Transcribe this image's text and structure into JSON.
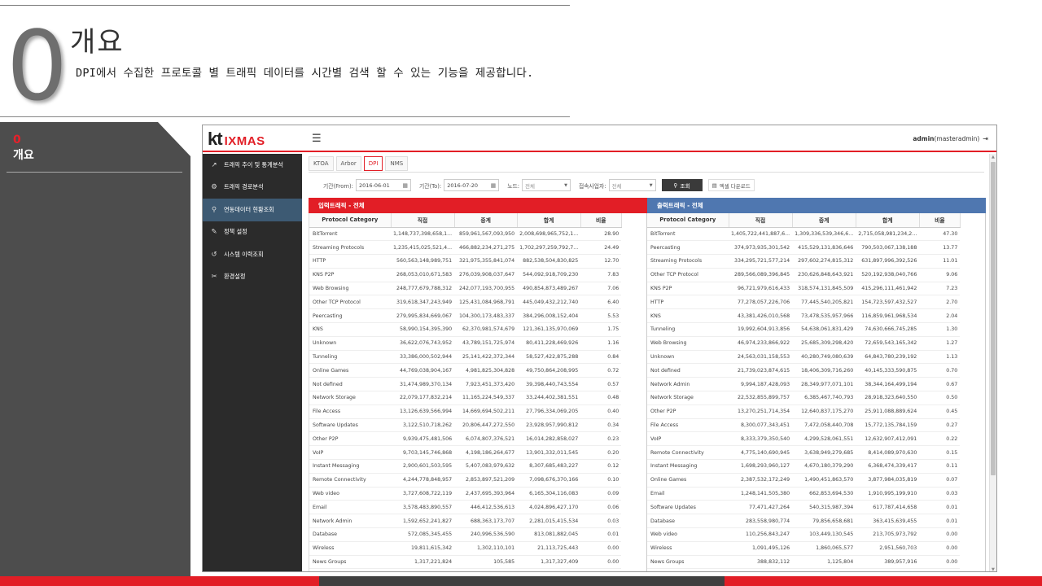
{
  "slide": {
    "number": "0",
    "title": "개요",
    "description": "DPI에서 수집한 프로토콜 별 트래픽 데이터를 시간별 검색 할 수 있는 기능을 제공합니다.",
    "side_number": "0",
    "side_label": "개요"
  },
  "colors": {
    "accent": "#e21e26",
    "dark": "#404040",
    "outbound": "#4f77b0",
    "sidebar": "#2b2b2b",
    "sidebar_active": "#3d5a73"
  },
  "app": {
    "logo_kt": "kt",
    "logo_product": "IXMAS",
    "menu_icon": "hamburger-icon",
    "user": "admin",
    "user_role": "(masteradmin)",
    "logout_icon": "logout-icon"
  },
  "sidebar": {
    "items": [
      {
        "icon": "chart-line-icon",
        "glyph": "↗",
        "label": "트래픽 추이 및 통계분석",
        "active": false
      },
      {
        "icon": "gear-route-icon",
        "glyph": "⚙",
        "label": "트래픽 경로분석",
        "active": false
      },
      {
        "icon": "search-icon",
        "glyph": "⚲",
        "label": "연동데이터 현황조회",
        "active": true
      },
      {
        "icon": "policy-icon",
        "glyph": "✎",
        "label": "정책 설정",
        "active": false
      },
      {
        "icon": "history-icon",
        "glyph": "↺",
        "label": "시스템 이력조회",
        "active": false
      },
      {
        "icon": "wrench-icon",
        "glyph": "✂",
        "label": "환경설정",
        "active": false
      }
    ]
  },
  "tabs": [
    {
      "label": "KTOA",
      "active": false
    },
    {
      "label": "Arbor",
      "active": false
    },
    {
      "label": "DPI",
      "active": true
    },
    {
      "label": "NMS",
      "active": false
    }
  ],
  "filters": {
    "from_label": "기간(From):",
    "from_value": "2016-06-01",
    "to_label": "기간(To):",
    "to_value": "2016-07-20",
    "node_label": "노드:",
    "node_value": "전체",
    "site_label": "접속사업자:",
    "site_value": "전체",
    "search_button": "조회",
    "excel_button": "엑셀 다운로드"
  },
  "columns": [
    "Protocol Category",
    "직접",
    "중계",
    "합계",
    "비율"
  ],
  "inbound": {
    "title": "입력트래픽 - 전체",
    "rows": [
      [
        "BitTorrent",
        "1,148,737,398,658,1...",
        "859,961,567,093,950",
        "2,008,698,965,752,1...",
        "28.90"
      ],
      [
        "Streaming Protocols",
        "1,235,415,025,521,4...",
        "466,882,234,271,275",
        "1,702,297,259,792,7...",
        "24.49"
      ],
      [
        "HTTP",
        "560,563,148,989,751",
        "321,975,355,841,074",
        "882,538,504,830,825",
        "12.70"
      ],
      [
        "KNS P2P",
        "268,053,010,671,583",
        "276,039,908,037,647",
        "544,092,918,709,230",
        "7.83"
      ],
      [
        "Web Browsing",
        "248,777,679,788,312",
        "242,077,193,700,955",
        "490,854,873,489,267",
        "7.06"
      ],
      [
        "Other TCP Protocol",
        "319,618,347,243,949",
        "125,431,084,968,791",
        "445,049,432,212,740",
        "6.40"
      ],
      [
        "Peercasting",
        "279,995,834,669,067",
        "104,300,173,483,337",
        "384,296,008,152,404",
        "5.53"
      ],
      [
        "KNS",
        "58,990,154,395,390",
        "62,370,981,574,679",
        "121,361,135,970,069",
        "1.75"
      ],
      [
        "Unknown",
        "36,622,076,743,952",
        "43,789,151,725,974",
        "80,411,228,469,926",
        "1.16"
      ],
      [
        "Tunneling",
        "33,386,000,502,944",
        "25,141,422,372,344",
        "58,527,422,875,288",
        "0.84"
      ],
      [
        "Online Games",
        "44,769,038,904,167",
        "4,981,825,304,828",
        "49,750,864,208,995",
        "0.72"
      ],
      [
        "Not defined",
        "31,474,989,370,134",
        "7,923,451,373,420",
        "39,398,440,743,554",
        "0.57"
      ],
      [
        "Network Storage",
        "22,079,177,832,214",
        "11,165,224,549,337",
        "33,244,402,381,551",
        "0.48"
      ],
      [
        "File Access",
        "13,126,639,566,994",
        "14,669,694,502,211",
        "27,796,334,069,205",
        "0.40"
      ],
      [
        "Software Updates",
        "3,122,510,718,262",
        "20,806,447,272,550",
        "23,928,957,990,812",
        "0.34"
      ],
      [
        "Other P2P",
        "9,939,475,481,506",
        "6,074,807,376,521",
        "16,014,282,858,027",
        "0.23"
      ],
      [
        "VoIP",
        "9,703,145,746,868",
        "4,198,186,264,677",
        "13,901,332,011,545",
        "0.20"
      ],
      [
        "Instant Messaging",
        "2,900,601,503,595",
        "5,407,083,979,632",
        "8,307,685,483,227",
        "0.12"
      ],
      [
        "Remote Connectivity",
        "4,244,778,848,957",
        "2,853,897,521,209",
        "7,098,676,370,166",
        "0.10"
      ],
      [
        "Web video",
        "3,727,608,722,119",
        "2,437,695,393,964",
        "6,165,304,116,083",
        "0.09"
      ],
      [
        "Email",
        "3,578,483,890,557",
        "446,412,536,613",
        "4,024,896,427,170",
        "0.06"
      ],
      [
        "Network Admin",
        "1,592,652,241,827",
        "688,363,173,707",
        "2,281,015,415,534",
        "0.03"
      ],
      [
        "Database",
        "572,085,345,455",
        "240,996,536,590",
        "813,081,882,045",
        "0.01"
      ],
      [
        "Wireless",
        "19,811,615,342",
        "1,302,110,101",
        "21,113,725,443",
        "0.00"
      ],
      [
        "News Groups",
        "1,317,221,824",
        "105,585",
        "1,317,327,409",
        "0.00"
      ]
    ]
  },
  "outbound": {
    "title": "출력트래픽 - 전체",
    "rows": [
      [
        "BitTorrent",
        "1,405,722,441,887,6...",
        "1,309,336,539,346,6...",
        "2,715,058,981,234,2...",
        "47.30"
      ],
      [
        "Peercasting",
        "374,973,935,301,542",
        "415,529,131,836,646",
        "790,503,067,138,188",
        "13.77"
      ],
      [
        "Streaming Protocols",
        "334,295,721,577,214",
        "297,602,274,815,312",
        "631,897,996,392,526",
        "11.01"
      ],
      [
        "Other TCP Protocol",
        "289,566,089,396,845",
        "230,626,848,643,921",
        "520,192,938,040,766",
        "9.06"
      ],
      [
        "KNS P2P",
        "96,721,979,616,433",
        "318,574,131,845,509",
        "415,296,111,461,942",
        "7.23"
      ],
      [
        "HTTP",
        "77,278,057,226,706",
        "77,445,540,205,821",
        "154,723,597,432,527",
        "2.70"
      ],
      [
        "KNS",
        "43,381,426,010,568",
        "73,478,535,957,966",
        "116,859,961,968,534",
        "2.04"
      ],
      [
        "Tunneling",
        "19,992,604,913,856",
        "54,638,061,831,429",
        "74,630,666,745,285",
        "1.30"
      ],
      [
        "Web Browsing",
        "46,974,233,866,922",
        "25,685,309,298,420",
        "72,659,543,165,342",
        "1.27"
      ],
      [
        "Unknown",
        "24,563,031,158,553",
        "40,280,749,080,639",
        "64,843,780,239,192",
        "1.13"
      ],
      [
        "Not defined",
        "21,739,023,874,615",
        "18,406,309,716,260",
        "40,145,333,590,875",
        "0.70"
      ],
      [
        "Network Admin",
        "9,994,187,428,093",
        "28,349,977,071,101",
        "38,344,164,499,194",
        "0.67"
      ],
      [
        "Network Storage",
        "22,532,855,899,757",
        "6,385,467,740,793",
        "28,918,323,640,550",
        "0.50"
      ],
      [
        "Other P2P",
        "13,270,251,714,354",
        "12,640,837,175,270",
        "25,911,088,889,624",
        "0.45"
      ],
      [
        "File Access",
        "8,300,077,343,451",
        "7,472,058,440,708",
        "15,772,135,784,159",
        "0.27"
      ],
      [
        "VoIP",
        "8,333,379,350,540",
        "4,299,528,061,551",
        "12,632,907,412,091",
        "0.22"
      ],
      [
        "Remote Connectivity",
        "4,775,140,690,945",
        "3,638,949,279,685",
        "8,414,089,970,630",
        "0.15"
      ],
      [
        "Instant Messaging",
        "1,698,293,960,127",
        "4,670,180,379,290",
        "6,368,474,339,417",
        "0.11"
      ],
      [
        "Online Games",
        "2,387,532,172,249",
        "1,490,451,863,570",
        "3,877,984,035,819",
        "0.07"
      ],
      [
        "Email",
        "1,248,141,505,380",
        "662,853,694,530",
        "1,910,995,199,910",
        "0.03"
      ],
      [
        "Software Updates",
        "77,471,427,264",
        "540,315,987,394",
        "617,787,414,658",
        "0.01"
      ],
      [
        "Database",
        "283,558,980,774",
        "79,856,658,681",
        "363,415,639,455",
        "0.01"
      ],
      [
        "Web video",
        "110,256,843,247",
        "103,449,130,545",
        "213,705,973,792",
        "0.00"
      ],
      [
        "Wireless",
        "1,091,495,126",
        "1,860,065,577",
        "2,951,560,703",
        "0.00"
      ],
      [
        "News Groups",
        "388,832,112",
        "1,125,804",
        "389,957,916",
        "0.00"
      ]
    ]
  }
}
